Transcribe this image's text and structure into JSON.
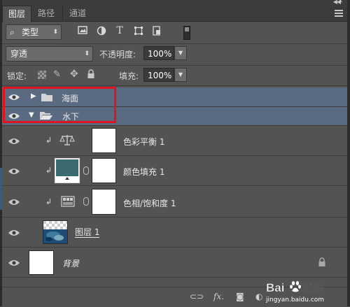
{
  "tabs": [
    "图层",
    "路径",
    "通道"
  ],
  "filter": {
    "kind_label": "类型"
  },
  "blend": {
    "mode": "穿透",
    "opacity_label": "不透明度:",
    "opacity_value": "100%"
  },
  "lock": {
    "label": "锁定:",
    "fill_label": "填充:",
    "fill_value": "100%"
  },
  "layers": {
    "group1": "海面",
    "group2": "水下",
    "adj1": "色彩平衡 1",
    "fill1": "颜色填充 1",
    "adj2": "色相/饱和度 1",
    "layer1": "图层 1",
    "background": "背景"
  },
  "colors": {
    "fill_swatch": "#3b6a70",
    "annotation": "#e0141e",
    "selected_group": "#5a6a80"
  },
  "watermark": {
    "brand": "Bai",
    "brand2": "经验",
    "url": "jingyan.baidu.com"
  }
}
